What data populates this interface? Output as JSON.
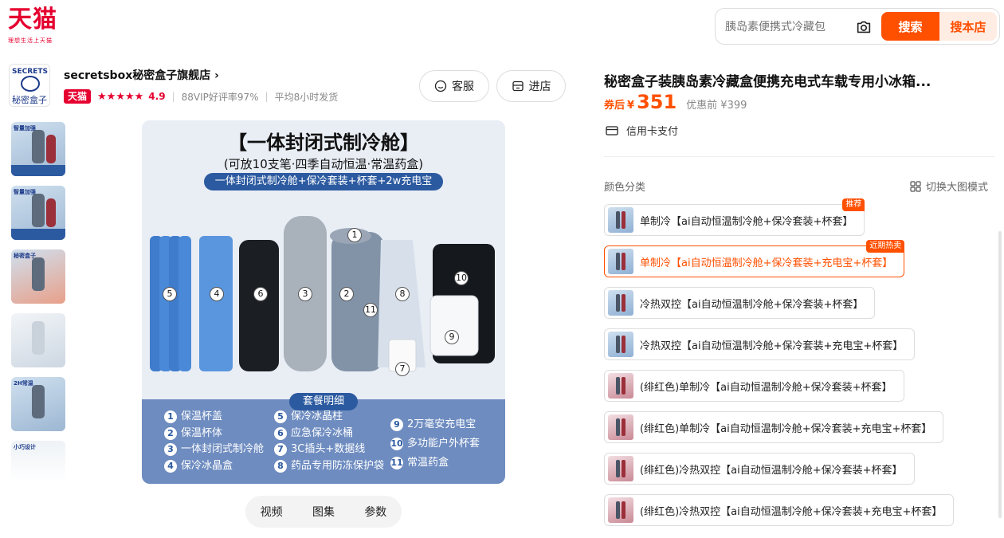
{
  "header": {
    "logo_text": "天猫",
    "logo_tagline": "理想生活上天猫",
    "search_placeholder": "胰岛素便携式冷藏包",
    "search_button": "搜索",
    "search_store_button": "搜本店"
  },
  "store": {
    "logo_text_top": "SECRETS",
    "logo_text_bottom": "秘密盒子",
    "name": "secretsbox秘密盒子旗舰店 ›",
    "badge": "天猫",
    "stars": "★★★★★",
    "score": "4.9",
    "vip_rating": "88VIP好评率97%",
    "ship_time": "平均8小时发货",
    "service_button": "客服",
    "enter_button": "进店"
  },
  "thumbnails": [
    {
      "label": "智量加强"
    },
    {
      "label": "智量加强"
    },
    {
      "label": "秘密盒子"
    },
    {
      "label": ""
    },
    {
      "label": "2H常温"
    },
    {
      "label": "小巧设计"
    }
  ],
  "main_image": {
    "title": "【一体封闭式制冷舱】",
    "subtitle": "(可放10支笔·四季自动恒温·常温药盒)",
    "band": "一体封闭式制冷舱+保冷套装+杯套+2w充电宝",
    "product_numbers": [
      "1",
      "2",
      "3",
      "4",
      "5",
      "6",
      "7",
      "8",
      "9",
      "10",
      "11"
    ],
    "box_title": "套餐明细",
    "list_col1": [
      {
        "n": "1",
        "t": "保温杯盖"
      },
      {
        "n": "2",
        "t": "保温杯体"
      },
      {
        "n": "3",
        "t": "一体封闭式制冷舱"
      },
      {
        "n": "4",
        "t": "保冷冰晶盒"
      }
    ],
    "list_col2": [
      {
        "n": "5",
        "t": "保冷冰晶柱"
      },
      {
        "n": "6",
        "t": "应急保冷冰桶"
      },
      {
        "n": "7",
        "t": "3C插头+数据线"
      },
      {
        "n": "8",
        "t": "药品专用防冻保护袋"
      }
    ],
    "list_col3": [
      {
        "n": "9",
        "t": "2万毫安充电宝"
      },
      {
        "n": "10",
        "t": "多功能户外杯套"
      },
      {
        "n": "11",
        "t": "常温药盒"
      }
    ]
  },
  "media_tabs": [
    "视频",
    "图集",
    "参数"
  ],
  "product": {
    "title": "秘密盒子装胰岛素冷藏盒便携充电式车载专用小冰箱...",
    "price_label": "券后",
    "price_symbol": "¥",
    "price": "351",
    "original_price": "优惠前 ¥399",
    "payment": "信用卡支付",
    "sku_title": "颜色分类",
    "toggle_label": "切换大图模式",
    "skus": [
      {
        "label": "单制冷【ai自动恒温制冷舱+保冷套装+杯套】",
        "tag": "推荐",
        "selected": false,
        "variant": "blue"
      },
      {
        "label": "单制冷【ai自动恒温制冷舱+保冷套装+充电宝+杯套】",
        "tag": "近期热卖",
        "selected": true,
        "variant": "blue"
      },
      {
        "label": "冷热双控【ai自动恒温制冷舱+保冷套装+杯套】",
        "tag": "",
        "selected": false,
        "variant": "blue"
      },
      {
        "label": "冷热双控【ai自动恒温制冷舱+保冷套装+充电宝+杯套】",
        "tag": "",
        "selected": false,
        "variant": "blue"
      },
      {
        "label": "(绯红色)单制冷【ai自动恒温制冷舱+保冷套装+杯套】",
        "tag": "",
        "selected": false,
        "variant": "red"
      },
      {
        "label": "(绯红色)单制冷【ai自动恒温制冷舱+保冷套装+充电宝+杯套】",
        "tag": "",
        "selected": false,
        "variant": "red"
      },
      {
        "label": "(绯红色)冷热双控【ai自动恒温制冷舱+保冷套装+杯套】",
        "tag": "",
        "selected": false,
        "variant": "red"
      },
      {
        "label": "(绯红色)冷热双控【ai自动恒温制冷舱+保冷套装+充电宝+杯套】",
        "tag": "",
        "selected": false,
        "variant": "red"
      }
    ]
  },
  "colors": {
    "brand_red": "#e5002f",
    "accent_orange": "#ff5000",
    "image_blue": "#2c5aa0"
  }
}
